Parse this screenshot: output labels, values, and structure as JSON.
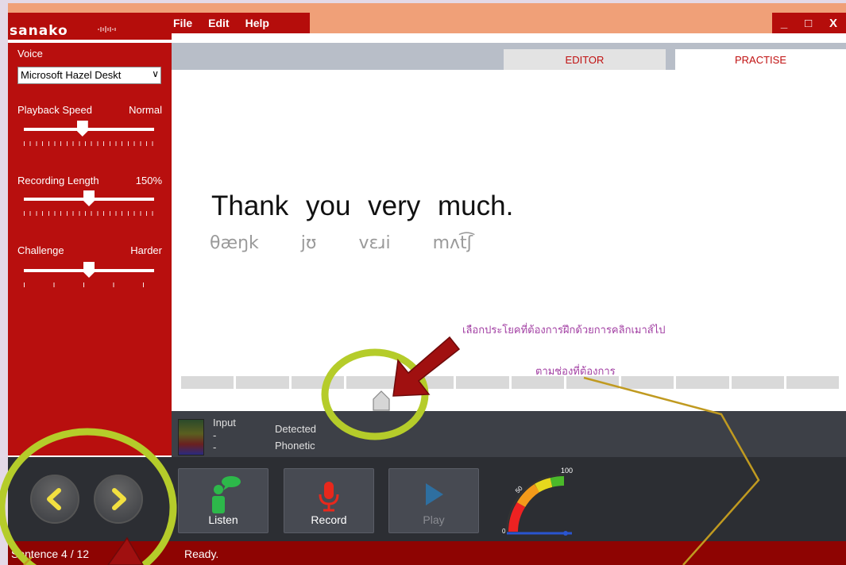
{
  "app": {
    "logo": "sanako",
    "menu": [
      "File",
      "Edit",
      "Help"
    ],
    "window_controls": [
      "_",
      "□",
      "X"
    ]
  },
  "left_panel": {
    "voice_label": "Voice",
    "voice_value": "Microsoft Hazel Deskt",
    "playback_speed": {
      "label": "Playback Speed",
      "value": "Normal",
      "level": 0.45
    },
    "recording_length": {
      "label": "Recording Length",
      "value": "150%",
      "level": 0.5
    },
    "challenge": {
      "label": "Challenge",
      "value": "Harder",
      "level": 0.5
    }
  },
  "tabs": {
    "editor": "EDITOR",
    "practise": "PRACTISE"
  },
  "content": {
    "sentence": "Thank you very much.",
    "phonetic": [
      "θæŋk",
      "jʊ",
      "vɛɹi",
      "mʌt͡ʃ"
    ],
    "note_line1": "เลือกประโยคที่ต้องการฝึกด้วยการคลิกเมาส์ไป",
    "note_line2": "ตามช่องที่ต้องการ",
    "segment_count": 12
  },
  "info": {
    "input_label": "Input",
    "input_dash1": "-",
    "input_dash2": "-",
    "detected_label": "Detected",
    "phonetic_label": "Phonetic"
  },
  "controls": {
    "listen": "Listen",
    "record": "Record",
    "play": "Play",
    "gauge_max": "100",
    "gauge_mid": "50",
    "gauge_min": "0"
  },
  "status": {
    "sentence_counter": "Sentence 4 / 12",
    "state": "Ready."
  },
  "colors": {
    "brand_red": "#b80f0e",
    "annotation_yellow": "#b5cc2a",
    "annotation_arrow": "#a01010",
    "note_purple": "#a23fa3"
  }
}
